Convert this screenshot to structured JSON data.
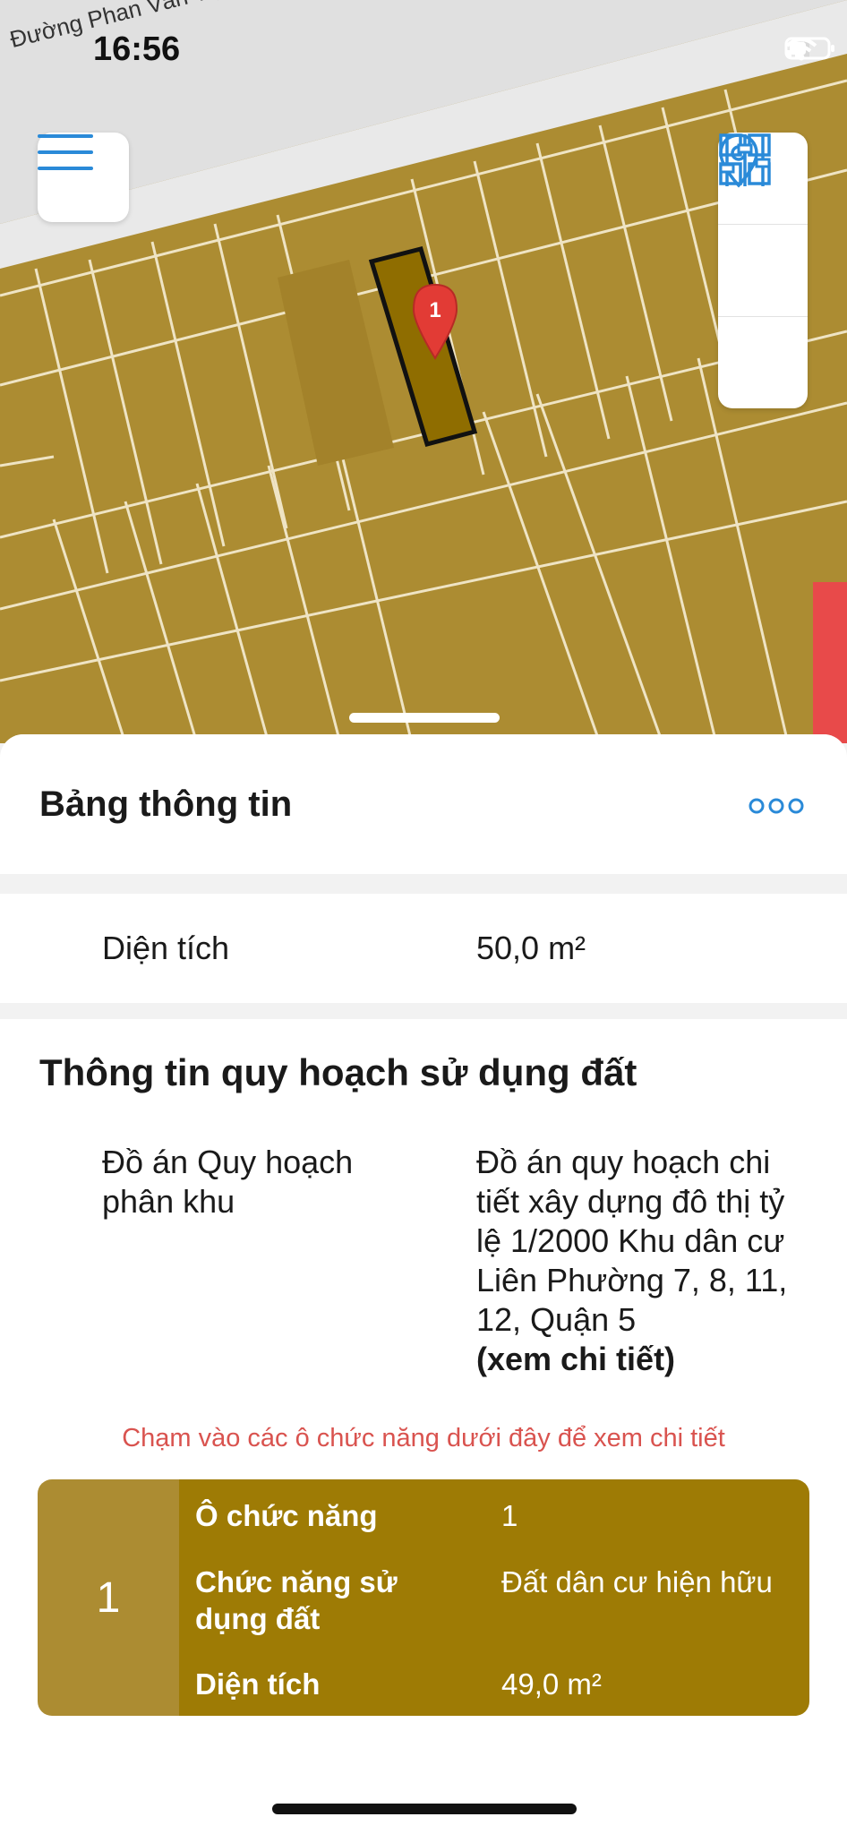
{
  "status_bar": {
    "time": "16:56"
  },
  "map": {
    "street_label": "Đường Phan Văn Trị",
    "marker_label": "1"
  },
  "sheet": {
    "title": "Bảng thông tin",
    "area": {
      "label": "Diện tích",
      "value": "50,0 m²"
    },
    "planning": {
      "title": "Thông tin quy hoạch sử dụng đất",
      "plan_label": "Đồ án Quy hoạch phân khu",
      "plan_value": "Đồ án quy hoạch chi tiết xây dựng đô thị tỷ lệ 1/2000 Khu dân cư Liên Phường 7, 8, 11, 12, Quận 5",
      "plan_link": "(xem chi tiết)"
    },
    "hint": "Chạm vào các ô chức năng dưới đây để xem chi tiết",
    "function_card": {
      "index": "1",
      "rows": [
        {
          "label": "Ô chức năng",
          "value": "1"
        },
        {
          "label": "Chức năng sử dụng đất",
          "value": "Đất dân cư hiện hữu"
        },
        {
          "label": "Diện tích",
          "value": "49,0 m²"
        }
      ]
    }
  },
  "colors": {
    "land": "#ac8c32",
    "selected": "#8f6d00",
    "card_right": "#9e7b05",
    "marker": "#e23b35",
    "accent": "#2a8ad8",
    "hint": "#d9534f"
  },
  "icons": [
    "menu-icon",
    "grid-icon",
    "location-pin-icon",
    "sliders-icon",
    "more-dots-icon",
    "signal-icon",
    "wifi-icon",
    "battery-icon",
    "map-marker-icon"
  ]
}
